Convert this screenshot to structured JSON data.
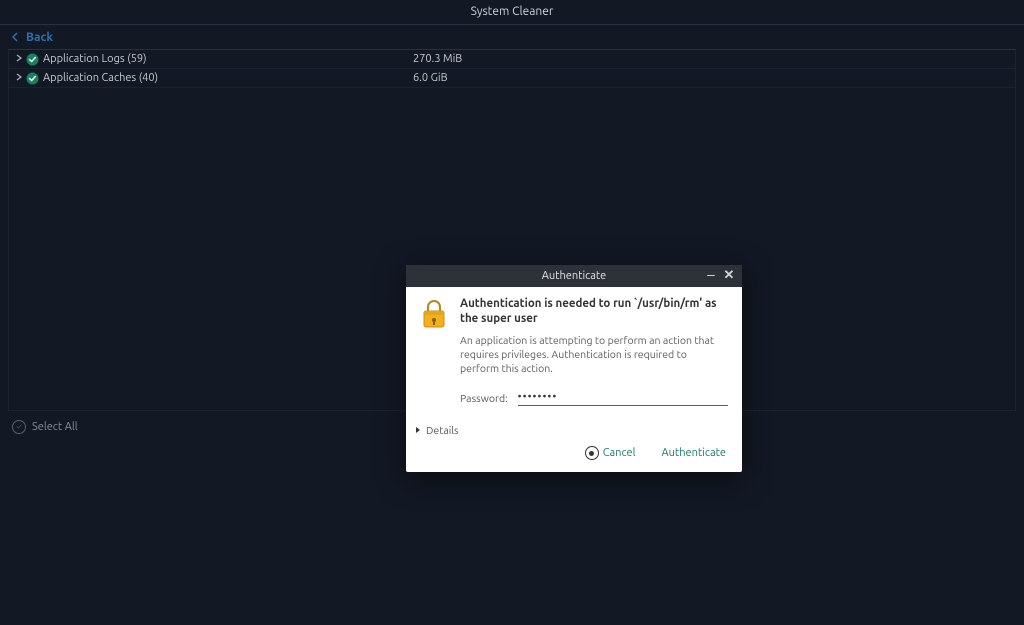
{
  "window": {
    "title": "System Cleaner"
  },
  "toolbar": {
    "back_label": "Back"
  },
  "list": {
    "rows": [
      {
        "name": "Application Logs (59)",
        "size": "270.3 MiB"
      },
      {
        "name": "Application Caches (40)",
        "size": "6.0 GiB"
      }
    ]
  },
  "footer": {
    "select_all_label": "Select All"
  },
  "dialog": {
    "title": "Authenticate",
    "heading": "Authentication is needed to run `/usr/bin/rm' as the super user",
    "description": "An application is attempting to perform an action that requires privileges. Authentication is required to perform this action.",
    "password_label": "Password:",
    "password_value": "••••••••",
    "details_label": "Details",
    "cancel_label": "Cancel",
    "authenticate_label": "Authenticate"
  }
}
